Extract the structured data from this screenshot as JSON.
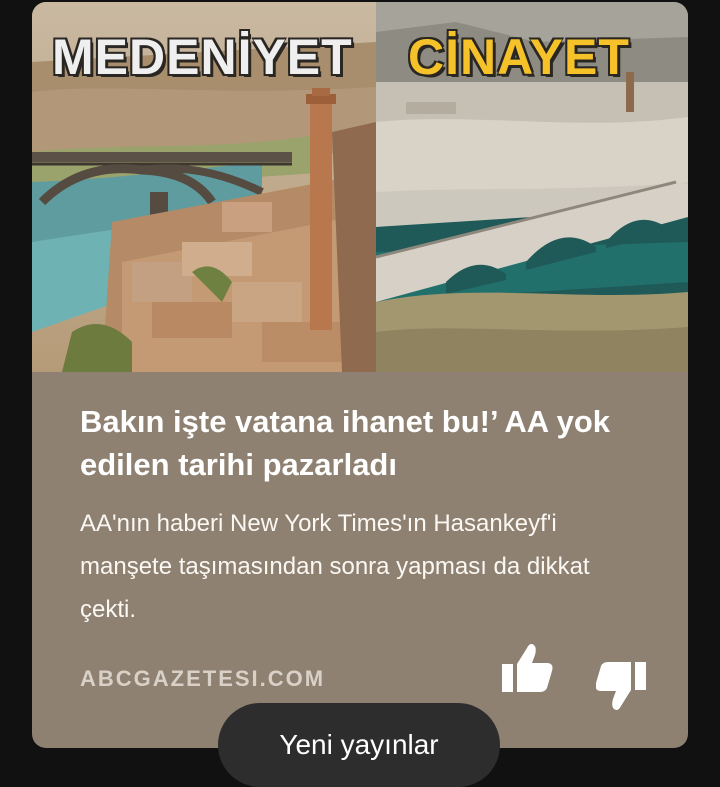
{
  "image": {
    "left_caption": "MEDENİYET",
    "right_caption": "CİNAYET"
  },
  "article": {
    "headline": "Bakın işte vatana ihanet bu!’ AA yok edilen tarihi pazarladı",
    "summary": "AA'nın haberi New York Times'ın Hasankeyf'i manşete taşımasından sonra yapması da dikkat çekti.",
    "source": "ABCGAZETESI.COM"
  },
  "actions": {
    "like_icon": "thumbs-up-icon",
    "dislike_icon": "thumbs-down-icon"
  },
  "feed": {
    "new_posts_label": "Yeni yayınlar"
  },
  "colors": {
    "background": "#111111",
    "card": "#8e8172",
    "headline": "#ffffff",
    "left_caption": "#efefef",
    "right_caption": "#f6c22a",
    "pill": "#2d2d2d"
  }
}
